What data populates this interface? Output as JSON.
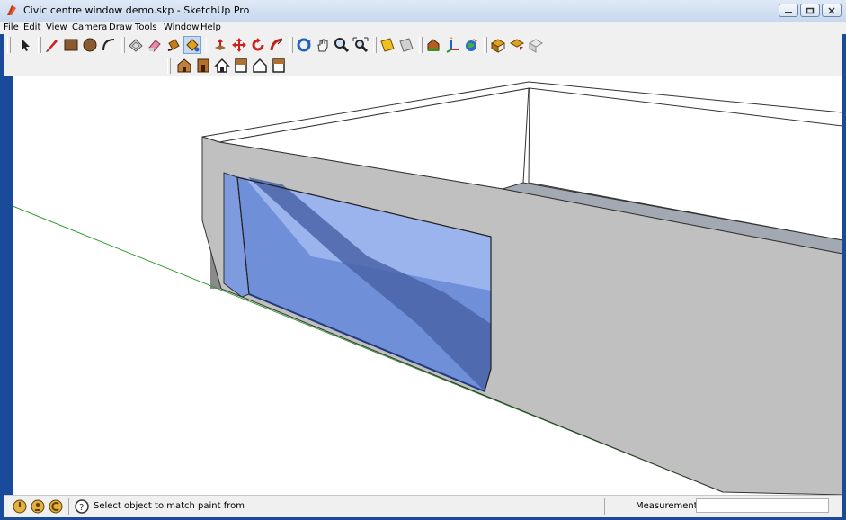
{
  "window": {
    "title": "Civic centre window demo.skp - SketchUp Pro"
  },
  "menu": {
    "file": "File",
    "edit": "Edit",
    "view": "View",
    "camera": "Camera",
    "draw": "Draw",
    "tools": "Tools",
    "window": "Window",
    "help": "Help"
  },
  "toolbar": {
    "tools": [
      "select-arrow-icon",
      "pencil-icon",
      "rectangle-icon",
      "circle-icon",
      "arc-icon",
      "eraser-icon",
      "tape-eraser-icon",
      "paint-bucket-icon",
      "match-paint-icon",
      "push-pull-icon",
      "move-icon",
      "rotate-icon",
      "follow-me-icon",
      "orbit-icon",
      "pan-hand-icon",
      "zoom-icon",
      "zoom-extents-icon",
      "section-plane-icon",
      "section-fill-icon",
      "components-icon",
      "axes-icon",
      "google-earth-icon",
      "get-models-icon",
      "share-model-icon",
      "upload-icon"
    ],
    "views": [
      "iso-view-icon",
      "front-view-icon",
      "house-view-icon",
      "top-view-icon",
      "side-view-icon",
      "bottom-view-icon"
    ]
  },
  "status": {
    "message": "Select object to match paint from",
    "measurements_label": "Measurements",
    "measurements_value": ""
  },
  "colors": {
    "wall": "#c0c0c0",
    "glass": "#6f8fd8",
    "ground_axis": "#2a9a2a"
  }
}
